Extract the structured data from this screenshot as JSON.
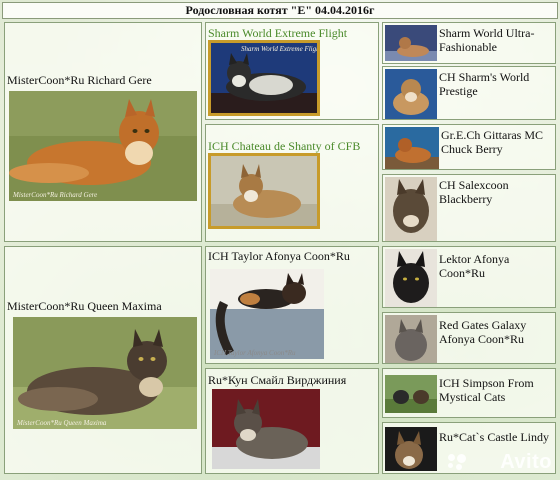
{
  "title": "Родословная котят \"Е\" 04.04.2016г",
  "parents": [
    {
      "name": "MisterCoon*Ru Richard Gere",
      "photo_caption": "MisterCoon*Ru Richard Gere"
    },
    {
      "name": "MisterCoon*Ru Queen Maxima",
      "photo_caption": "MisterCoon*Ru Queen Maxima"
    }
  ],
  "grandparents": [
    {
      "name": "Sharm World Extreme Flight",
      "photo_caption": "Sharm World Extreme Flight"
    },
    {
      "name": "ICH Chateau de Shanty of CFB"
    },
    {
      "name": "ICH Taylor Afonya Coon*Ru",
      "photo_caption": "ICH Taylor Afonya Coon*Ru"
    },
    {
      "name": "Ru*Кун Смайл Вирджиния"
    }
  ],
  "great_grandparents": [
    {
      "name": "Sharm World Ultra-Fashionable"
    },
    {
      "name": "CH Sharm's World Prestige"
    },
    {
      "name": "Gr.E.Ch Gittaras MC Chuck Berry"
    },
    {
      "name": "CH Salexcoon Blackberry"
    },
    {
      "name": "Lektor Afonya Coon*Ru"
    },
    {
      "name": "Red Gates Galaxy Afonya Coon*Ru"
    },
    {
      "name": "ICH Simpson From Mystical Cats"
    },
    {
      "name": "Ru*Cat`s Castle Lindy"
    }
  ],
  "watermark": "Avito"
}
